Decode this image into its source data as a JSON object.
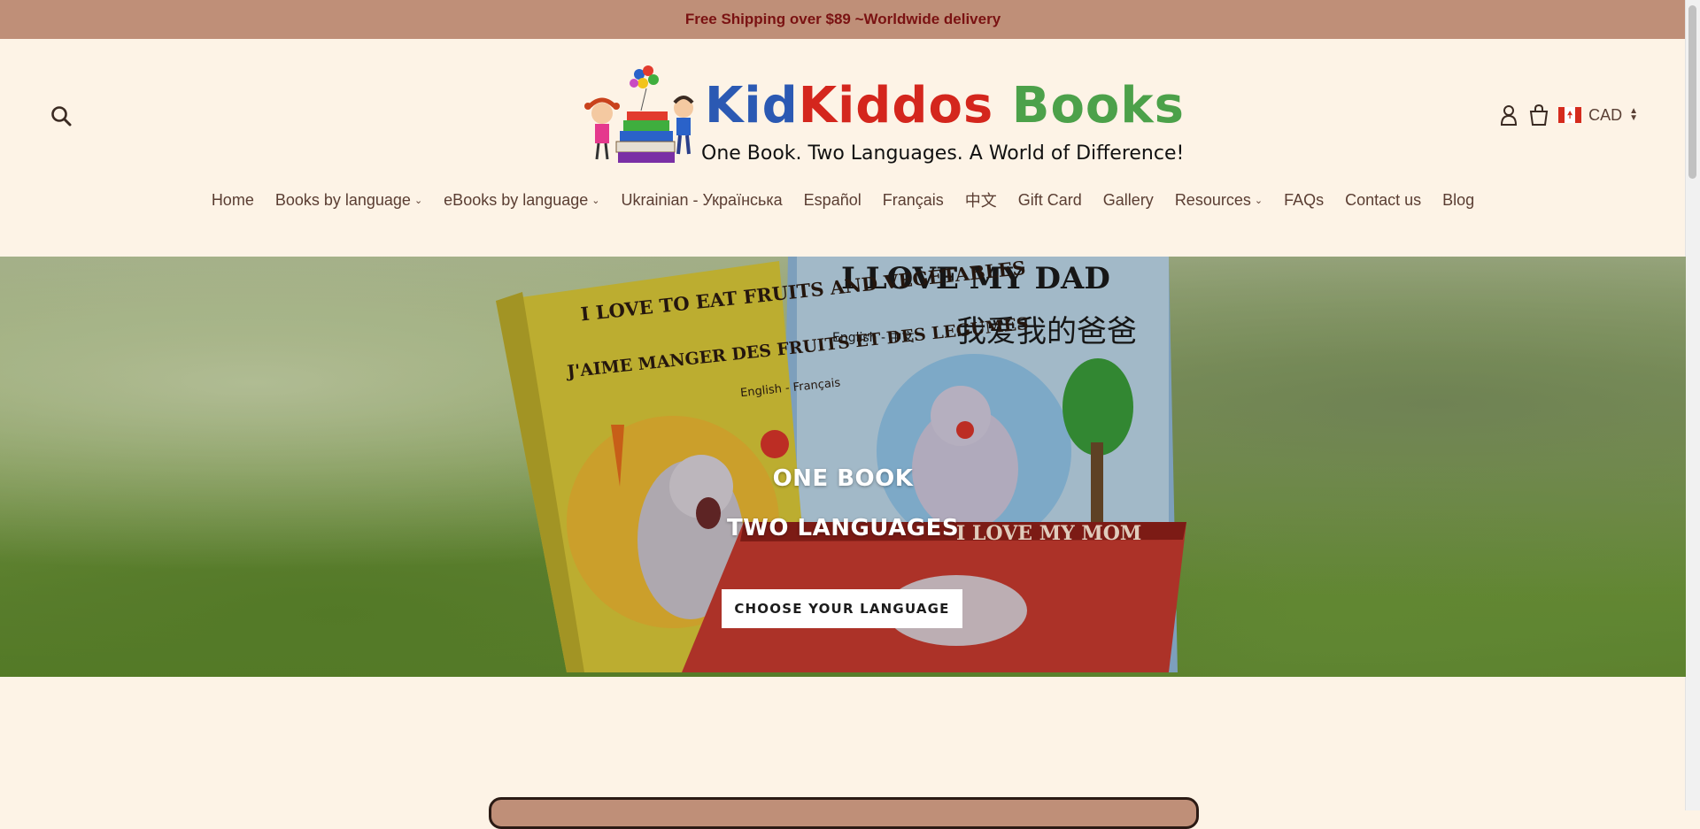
{
  "announcement": "Free Shipping over $89 ~Worldwide delivery",
  "header": {
    "logo_title_part1": "Kid",
    "logo_title_part2": "Kiddos",
    "logo_title_part3": "Books",
    "logo_tagline": "One Book. Two Languages. A World of Difference!",
    "currency": "CAD",
    "icons": [
      "search-icon",
      "account-icon",
      "cart-icon",
      "canada-flag-icon"
    ]
  },
  "nav": [
    {
      "label": "Home",
      "has_dropdown": false
    },
    {
      "label": "Books by language",
      "has_dropdown": true
    },
    {
      "label": "eBooks by language",
      "has_dropdown": true
    },
    {
      "label": "Ukrainian - Українська",
      "has_dropdown": false
    },
    {
      "label": "Español",
      "has_dropdown": false
    },
    {
      "label": "Français",
      "has_dropdown": false
    },
    {
      "label": "中文",
      "has_dropdown": false
    },
    {
      "label": "Gift Card",
      "has_dropdown": false
    },
    {
      "label": "Gallery",
      "has_dropdown": false
    },
    {
      "label": "Resources",
      "has_dropdown": true
    },
    {
      "label": "FAQs",
      "has_dropdown": false
    },
    {
      "label": "Contact us",
      "has_dropdown": false
    },
    {
      "label": "Blog",
      "has_dropdown": false
    }
  ],
  "hero": {
    "line1": "ONE BOOK",
    "line2": "TWO LANGUAGES",
    "cta": "CHOOSE YOUR LANGUAGE",
    "book1_title": "I LOVE TO EAT FRUITS AND VEGETABLES",
    "book1_subtitle": "J'AIME MANGER DES FRUITS ET DES LEGUMES",
    "book1_langs": "English - Français",
    "book2_title": "I LOVE MY DAD",
    "book2_chinese": "我爱我的爸爸",
    "book2_langs": "English - 中文",
    "book3_title": "I LOVE MY MOM"
  },
  "colors": {
    "background": "#fdf3e6",
    "announcement_bg": "#bf8f78",
    "announcement_text": "#7a1212",
    "nav_text": "#5a3d32"
  }
}
